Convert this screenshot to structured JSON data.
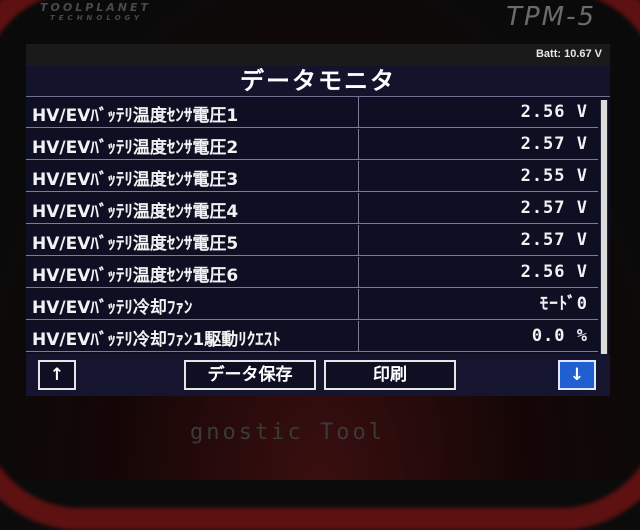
{
  "device": {
    "brand": "TOOLPLANET",
    "brand_sub": "TECHNOLOGY",
    "model": "TPM-5",
    "footer": "gnostic Tool"
  },
  "status": {
    "battery": "Batt: 10.67 V"
  },
  "title": "データモニタ",
  "rows": [
    {
      "label": "HV/EVﾊﾞｯﾃﾘ温度ｾﾝｻ電圧1",
      "value": "2.56 V"
    },
    {
      "label": "HV/EVﾊﾞｯﾃﾘ温度ｾﾝｻ電圧2",
      "value": "2.57 V"
    },
    {
      "label": "HV/EVﾊﾞｯﾃﾘ温度ｾﾝｻ電圧3",
      "value": "2.55 V"
    },
    {
      "label": "HV/EVﾊﾞｯﾃﾘ温度ｾﾝｻ電圧4",
      "value": "2.57 V"
    },
    {
      "label": "HV/EVﾊﾞｯﾃﾘ温度ｾﾝｻ電圧5",
      "value": "2.57 V"
    },
    {
      "label": "HV/EVﾊﾞｯﾃﾘ温度ｾﾝｻ電圧6",
      "value": "2.56 V"
    },
    {
      "label": "HV/EVﾊﾞｯﾃﾘ冷却ﾌｧﾝ",
      "value": "ﾓｰﾄﾞ0"
    },
    {
      "label": "HV/EVﾊﾞｯﾃﾘ冷却ﾌｧﾝ1駆動ﾘｸｴｽﾄ",
      "value": "0.0 %"
    }
  ],
  "buttons": {
    "up": "↑",
    "save": "データ保存",
    "print": "印刷",
    "down": "↓"
  },
  "colors": {
    "screen_bg": "#0e0e1e",
    "selected_button": "#1f5fcf",
    "housing_accent": "#7a1414"
  }
}
